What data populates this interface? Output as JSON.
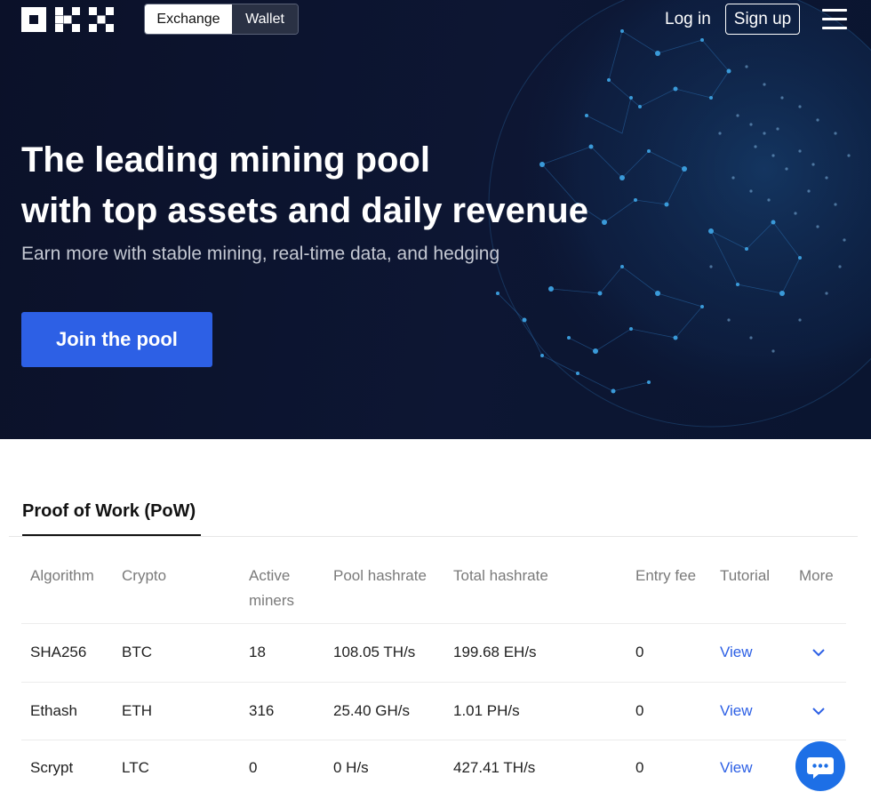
{
  "header": {
    "logo_text": "OKX",
    "segment": {
      "exchange_label": "Exchange",
      "wallet_label": "Wallet"
    },
    "login_label": "Log in",
    "signup_label": "Sign up"
  },
  "hero": {
    "title_line1": "The leading mining pool",
    "title_line2": "with top assets and daily revenue",
    "subtitle": "Earn more with stable mining, real-time data, and hedging",
    "cta_label": "Join the pool"
  },
  "pool_tab": {
    "label": "Proof of Work (PoW)"
  },
  "table": {
    "columns": {
      "algorithm": "Algorithm",
      "crypto": "Crypto",
      "active_miners_l1": "Active",
      "active_miners_l2": "miners",
      "pool_hashrate": "Pool hashrate",
      "total_hashrate": "Total hashrate",
      "entry_fee": "Entry fee",
      "tutorial": "Tutorial",
      "more": "More"
    },
    "rows": [
      {
        "algorithm": "SHA256",
        "crypto": "BTC",
        "active_miners": "18",
        "pool_hashrate": "108.05 TH/s",
        "total_hashrate": "199.68 EH/s",
        "entry_fee": "0",
        "tutorial": "View"
      },
      {
        "algorithm": "Ethash",
        "crypto": "ETH",
        "active_miners": "316",
        "pool_hashrate": "25.40 GH/s",
        "total_hashrate": "1.01 PH/s",
        "entry_fee": "0",
        "tutorial": "View"
      },
      {
        "algorithm": "Scrypt",
        "crypto": "LTC",
        "active_miners": "0",
        "pool_hashrate": "0 H/s",
        "total_hashrate": "427.41 TH/s",
        "entry_fee": "0",
        "tutorial": "View"
      }
    ]
  },
  "colors": {
    "hero_bg": "#0b1129",
    "accent": "#2d60e5",
    "chat": "#1d6fe6"
  },
  "icons": {
    "menu": "hamburger-menu-icon",
    "expand": "chevron-down-icon",
    "chat": "chat-bubble-icon"
  }
}
